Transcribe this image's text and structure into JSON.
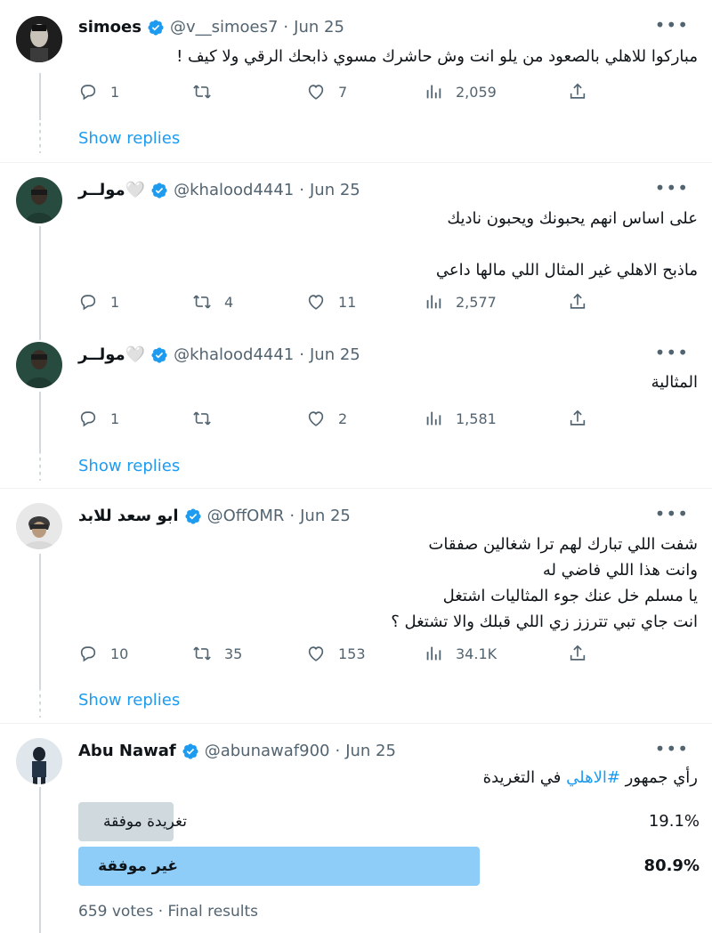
{
  "tweets": [
    {
      "display_name": "simoes",
      "handle": "@v__simoes7",
      "date": "Jun 25",
      "text_lines": [
        "مباركوا للاهلي بالصعود من يلو انت وش حاشرك مسوي ذابحك الرقي ولا كيف !"
      ],
      "reply_count": "1",
      "retweet_count": "",
      "like_count": "7",
      "view_count": "2,059",
      "show_replies": "Show replies"
    },
    {
      "display_name": "مولــر🤍",
      "handle": "@khalood4441",
      "date": "Jun 25",
      "text_lines": [
        "على اساس انهم يحبونك ويحبون ناديك",
        "",
        "ماذبح الاهلي غير المثال اللي مالها داعي"
      ],
      "reply_count": "1",
      "retweet_count": "4",
      "like_count": "11",
      "view_count": "2,577"
    },
    {
      "display_name": "مولــر🤍",
      "handle": "@khalood4441",
      "date": "Jun 25",
      "text_lines": [
        "المثالية"
      ],
      "reply_count": "1",
      "retweet_count": "",
      "like_count": "2",
      "view_count": "1,581",
      "show_replies": "Show replies"
    },
    {
      "display_name": "ابو سعد للابد",
      "handle": "@OffOMR",
      "date": "Jun 25",
      "text_lines": [
        "شفت اللي تبارك لهم ترا شغالين صفقات",
        "وانت هذا اللي فاضي له",
        "يا مسلم خل عنك جوء المثاليات اشتغل",
        "انت جاي تبي تترزز زي اللي قبلك والا تشتغل ؟"
      ],
      "reply_count": "10",
      "retweet_count": "35",
      "like_count": "153",
      "view_count": "34.1K",
      "show_replies": "Show replies"
    },
    {
      "display_name": "Abu Nawaf",
      "handle": "@abunawaf900",
      "date": "Jun 25",
      "text_before": "رأي جمهور ",
      "hashtag": "#الاهلي",
      "text_after": " في التغريدة",
      "poll": {
        "options": [
          {
            "label": "تغريدة موفقة",
            "percent_text": "19.1%",
            "percent": 19.1,
            "winner": false
          },
          {
            "label": "غير موفقة",
            "percent_text": "80.9%",
            "percent": 80.9,
            "winner": true
          }
        ],
        "footer": "659 votes · Final results"
      }
    }
  ],
  "icons": {
    "reply": "reply-icon",
    "retweet": "retweet-icon",
    "like": "heart-icon",
    "views": "views-icon",
    "share": "share-icon",
    "more": "more-icon",
    "verified": "verified-badge-icon"
  },
  "colors": {
    "accent": "#1d9bf0",
    "muted": "#536471",
    "poll_winner": "#8ecdf8",
    "poll_other": "#cfd9de"
  }
}
